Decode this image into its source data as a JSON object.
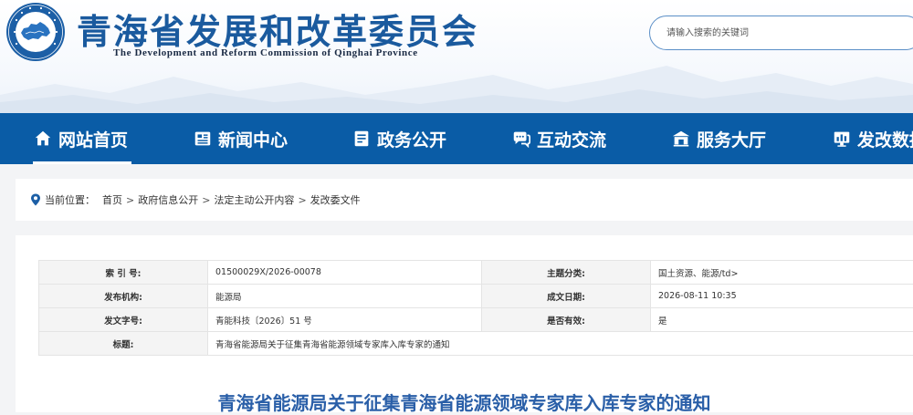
{
  "header": {
    "title": "青海省发展和改革委员会",
    "subtitle": "The Development and Reform Commission of Qinghai Province",
    "emblem_text": "青海省发展和改革委员会",
    "search_placeholder": "请输入搜索的关键词"
  },
  "colors": {
    "brand_blue": "#0a5ca6",
    "title_blue": "#1a5a9e",
    "doc_title_blue": "#2a5fa8"
  },
  "nav": {
    "items": [
      {
        "label": "网站首页",
        "icon": "home-icon",
        "active": true
      },
      {
        "label": "新闻中心",
        "icon": "newspaper-icon"
      },
      {
        "label": "政务公开",
        "icon": "document-icon"
      },
      {
        "label": "互动交流",
        "icon": "chat-icon"
      },
      {
        "label": "服务大厅",
        "icon": "hall-icon"
      },
      {
        "label": "发改数据",
        "icon": "data-chart-icon"
      }
    ]
  },
  "breadcrumb": {
    "prefix": "当前位置：",
    "items": [
      "首页",
      "政府信息公开",
      "法定主动公开内容",
      "发改委文件"
    ]
  },
  "meta": {
    "index_label": "索 引 号:",
    "index_value": "01500029X/2026-00078",
    "topic_label": "主题分类:",
    "topic_value": "国土资源、能源/td>",
    "org_label": "发布机构:",
    "org_value": "能源局",
    "date_label": "成文日期:",
    "date_value": "2026-08-11 10:35",
    "docno_label": "发文字号:",
    "docno_value": "青能科技〔2026〕51 号",
    "valid_label": "是否有效:",
    "valid_value": "是",
    "subject_label": "标题:",
    "subject_value": "青海省能源局关于征集青海省能源领域专家库入库专家的通知"
  },
  "document": {
    "title": "青海省能源局关于征集青海省能源领域专家库入库专家的通知"
  }
}
